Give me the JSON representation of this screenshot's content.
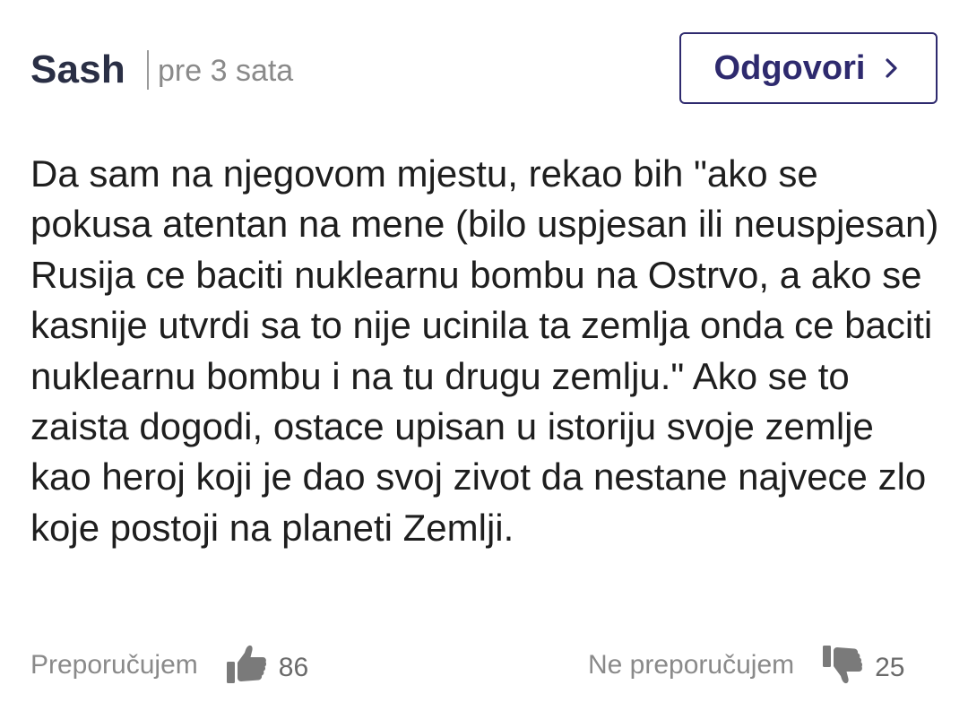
{
  "comment": {
    "author": "Sash",
    "timestamp": "pre 3 sata",
    "reply_label": "Odgovori",
    "body": "Da sam na njegovom mjestu, rekao bih \"ako se pokusa atentan na mene (bilo uspjesan ili neuspjesan) Rusija ce baciti nuklearnu bombu na Ostrvo, a ako se kasnije utvrdi sa to nije ucinila ta zemlja onda ce baciti nuklearnu bombu i na tu drugu zemlju.\" Ako se to zaista dogodi, ostace upisan u istoriju svoje zemlje kao heroj koji je dao svoj zivot da nestane najvece zlo koje postoji na planeti Zemlji."
  },
  "votes": {
    "up": {
      "label": "Preporučujem",
      "count": "86",
      "icon": "thumbs-up-icon"
    },
    "down": {
      "label": "Ne preporučujem",
      "count": "25",
      "icon": "thumbs-down-icon"
    }
  },
  "colors": {
    "accent": "#2e2a6e",
    "author": "#2a2f45",
    "muted": "#8a8a8a",
    "thumb": "#7a7a7a"
  }
}
